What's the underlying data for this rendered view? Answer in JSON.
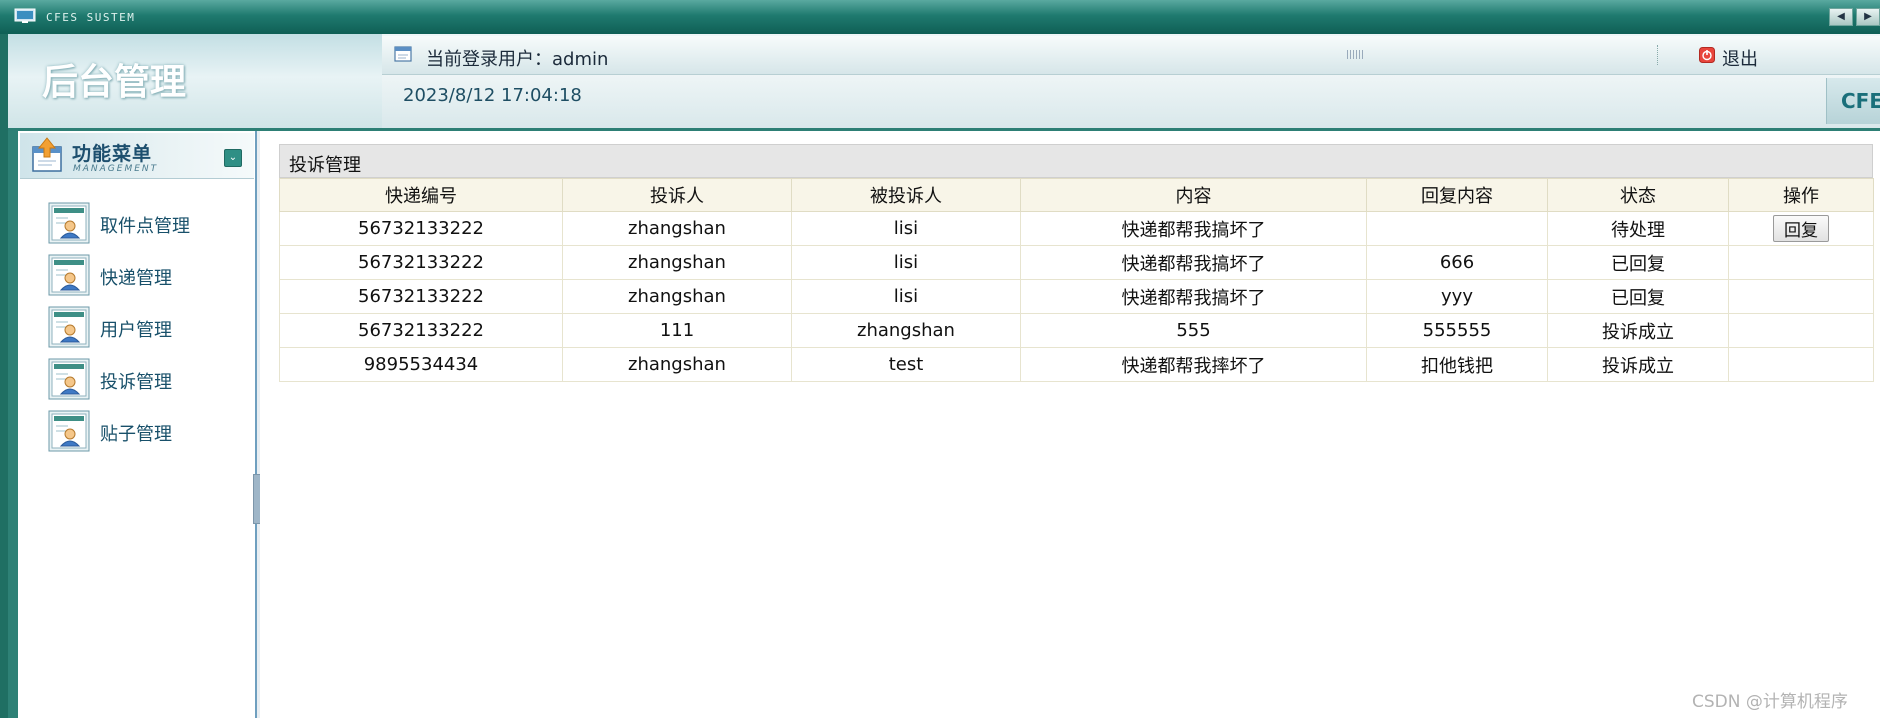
{
  "window": {
    "title": "CFES SUSTEM"
  },
  "header": {
    "brand": "后台管理",
    "user_label": "当前登录用户：admin",
    "datetime": "2023/8/12 17:04:18",
    "logout": "退出",
    "badge": "CFE"
  },
  "sidebar": {
    "title": "功能菜单",
    "subtitle": "MANAGEMENT",
    "items": [
      {
        "label": "取件点管理",
        "icon": "list-person-icon"
      },
      {
        "label": "快递管理",
        "icon": "list-person-icon"
      },
      {
        "label": "用户管理",
        "icon": "list-person-icon"
      },
      {
        "label": "投诉管理",
        "icon": "list-person-icon"
      },
      {
        "label": "贴子管理",
        "icon": "list-person-icon"
      }
    ]
  },
  "main": {
    "panel_title": "投诉管理",
    "columns": [
      "快递编号",
      "投诉人",
      "被投诉人",
      "内容",
      "回复内容",
      "状态",
      "操作"
    ],
    "rows": [
      {
        "id": "56732133222",
        "complainant": "zhangshan",
        "respondent": "lisi",
        "content": "快递都帮我搞坏了",
        "reply": "",
        "status": "待处理",
        "action": "回复"
      },
      {
        "id": "56732133222",
        "complainant": "zhangshan",
        "respondent": "lisi",
        "content": "快递都帮我搞坏了",
        "reply": "666",
        "status": "已回复",
        "action": ""
      },
      {
        "id": "56732133222",
        "complainant": "zhangshan",
        "respondent": "lisi",
        "content": "快递都帮我搞坏了",
        "reply": "yyy",
        "status": "已回复",
        "action": ""
      },
      {
        "id": "56732133222",
        "complainant": "111",
        "respondent": "zhangshan",
        "content": "555",
        "reply": "555555",
        "status": "投诉成立",
        "action": ""
      },
      {
        "id": "9895534434",
        "complainant": "zhangshan",
        "respondent": "test",
        "content": "快递都帮我摔坏了",
        "reply": "扣他钱把",
        "status": "投诉成立",
        "action": ""
      }
    ]
  },
  "watermark": "CSDN @计算机程序",
  "colors": {
    "accent": "#1f7a6f",
    "link": "#18506a",
    "header_bg": "#c9dfe3"
  }
}
